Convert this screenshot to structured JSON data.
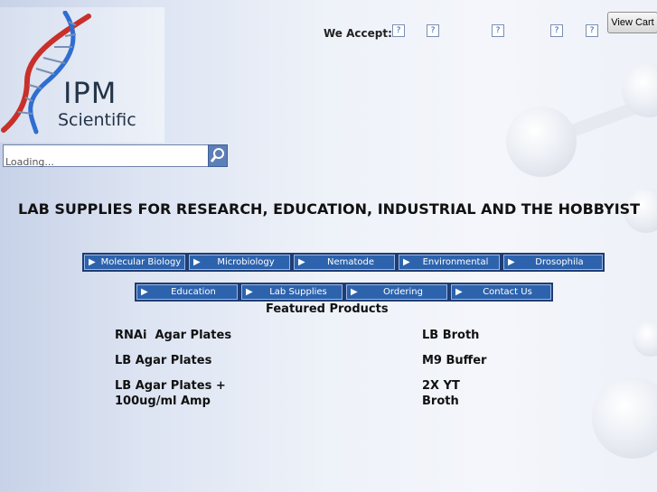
{
  "logo": {
    "line1": "IPM",
    "line2": "Scientific"
  },
  "payment": {
    "label": "We Accept:",
    "cards": [
      "?",
      "?",
      "?",
      "?",
      "?"
    ]
  },
  "cart": {
    "label": "View Cart"
  },
  "search": {
    "value": "Loading...",
    "icon": "magnifier-icon"
  },
  "tagline": "LAB SUPPLIES FOR RESEARCH, EDUCATION, INDUSTRIAL AND THE HOBBYIST",
  "nav": {
    "row1": [
      "Molecular Biology",
      "Microbiology",
      "Nematode",
      "Environmental",
      "Drosophila"
    ],
    "row2": [
      "Education",
      "Lab Supplies",
      "Ordering",
      "Contact Us"
    ]
  },
  "featured": {
    "heading": "Featured Products",
    "left": [
      "RNAi  Agar Plates",
      "LB Agar Plates",
      "LB Agar Plates +\n100ug/ml Amp"
    ],
    "right": [
      "LB Broth",
      "M9 Buffer",
      "2X YT\nBroth"
    ]
  },
  "colors": {
    "nav_bg": "#2d63ad",
    "nav_border": "#1f3d73",
    "dna_red": "#c8302a",
    "dna_blue": "#2e6ed1"
  }
}
